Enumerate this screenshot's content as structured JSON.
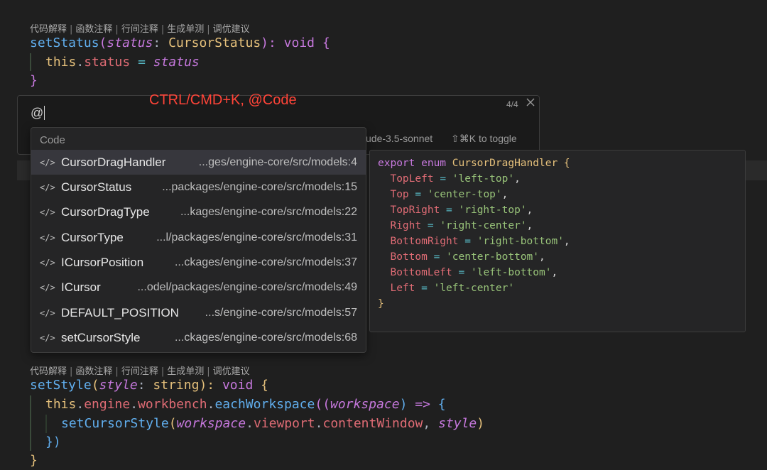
{
  "codelens": {
    "items": [
      "代码解释",
      "函数注释",
      "行间注释",
      "生成单测",
      "调优建议"
    ],
    "separator": "|"
  },
  "code_top": {
    "line1": {
      "fn": "setStatus",
      "open": "(",
      "param": "status",
      "colon": ": ",
      "type": "CursorStatus",
      "close": "): ",
      "ret": "void",
      "brace": " {"
    },
    "line2": {
      "this": "this",
      "dot": ".",
      "prop": "status",
      "eq": " = ",
      "val": "status"
    },
    "line3": "}"
  },
  "inline_prompt": {
    "value": "@",
    "counter": "4/4",
    "model_label": "ude-3.5-sonnet",
    "toggle_label": "⇧⌘K to toggle"
  },
  "annotation": "CTRL/CMD+K, @Code",
  "popup": {
    "header": "Code",
    "items": [
      {
        "name": "CursorDragHandler",
        "path": "...ges/engine-core/src/models:4",
        "selected": true
      },
      {
        "name": "CursorStatus",
        "path": "...packages/engine-core/src/models:15"
      },
      {
        "name": "CursorDragType",
        "path": "...kages/engine-core/src/models:22"
      },
      {
        "name": "CursorType",
        "path": "...l/packages/engine-core/src/models:31"
      },
      {
        "name": "ICursorPosition",
        "path": "...ckages/engine-core/src/models:37"
      },
      {
        "name": "ICursor",
        "path": "...odel/packages/engine-core/src/models:49"
      },
      {
        "name": "DEFAULT_POSITION",
        "path": "...s/engine-core/src/models:57"
      },
      {
        "name": "setCursorStyle",
        "path": "...ckages/engine-core/src/models:68"
      }
    ],
    "icon": "</>"
  },
  "preview": {
    "header": {
      "kw": "export enum",
      "name": "CursorDragHandler",
      "brace": "{"
    },
    "members": [
      {
        "key": "TopLeft",
        "val": "'left-top'",
        "comma": ","
      },
      {
        "key": "Top",
        "val": "'center-top'",
        "comma": ","
      },
      {
        "key": "TopRight",
        "val": "'right-top'",
        "comma": ","
      },
      {
        "key": "Right",
        "val": "'right-center'",
        "comma": ","
      },
      {
        "key": "BottomRight",
        "val": "'right-bottom'",
        "comma": ","
      },
      {
        "key": "Bottom",
        "val": "'center-bottom'",
        "comma": ","
      },
      {
        "key": "BottomLeft",
        "val": "'left-bottom'",
        "comma": ","
      },
      {
        "key": "Left",
        "val": "'left-center'",
        "comma": ""
      }
    ],
    "close": "}"
  },
  "code_bottom": {
    "line1": {
      "fn": "setStyle",
      "open": "(",
      "param": "style",
      "colon": ": ",
      "type": "string",
      "close": "): ",
      "ret": "void",
      "brace": " {"
    },
    "line2": {
      "this": "this",
      "p1": "engine",
      "p2": "workbench",
      "fn": "eachWorkspace",
      "open": "((",
      "param": "workspace",
      "close": ")",
      "arrow": " => ",
      "brace": "{"
    },
    "line3": {
      "fn": "setCursorStyle",
      "open": "(",
      "param1": "workspace",
      "p1": "viewport",
      "p2": "contentWindow",
      "comma": ", ",
      "param2": "style",
      "close": ")"
    },
    "line4": "})",
    "line5": "}"
  },
  "colors": {
    "annotation": "#ff4438",
    "background": "#1f1f1f"
  }
}
